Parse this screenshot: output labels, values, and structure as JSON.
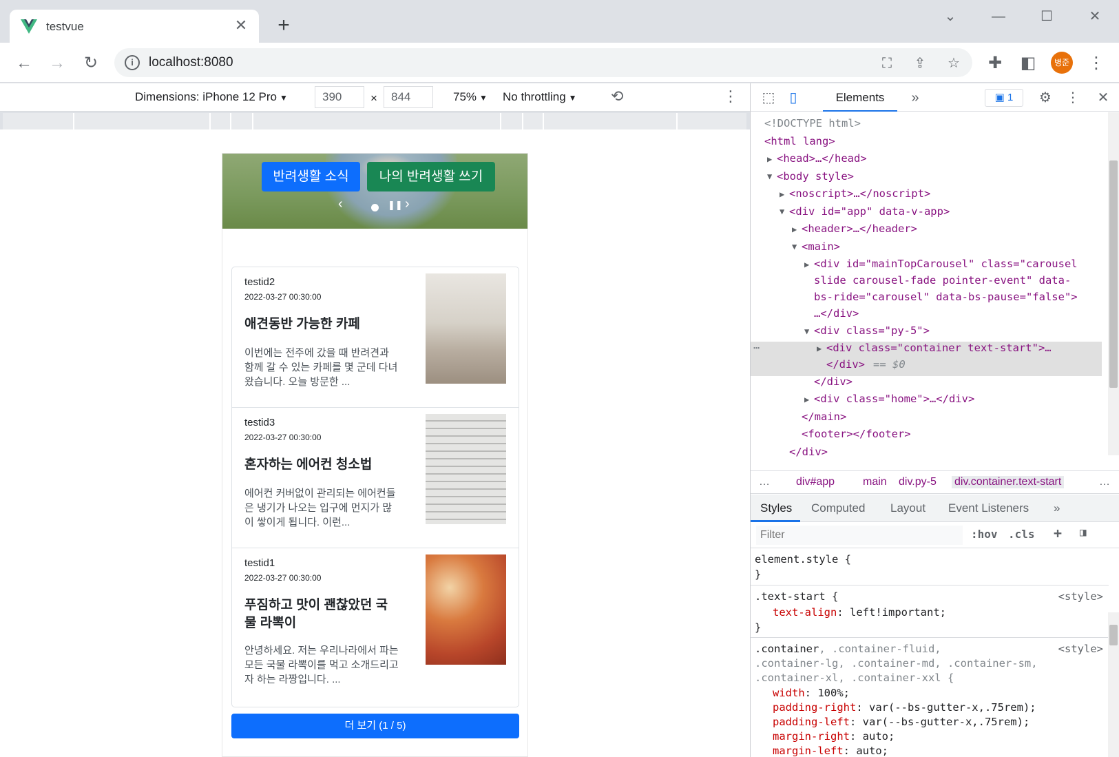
{
  "browser": {
    "tab_title": "testvue",
    "url": "localhost:8080",
    "profile_initials": "병준"
  },
  "device_toolbar": {
    "dimensions_label": "Dimensions: iPhone 12 Pro",
    "width": "390",
    "height": "844",
    "times": "×",
    "zoom": "75%",
    "throttling": "No throttling"
  },
  "page": {
    "carousel": {
      "btn_news": "반려생활 소식",
      "btn_write": "나의 반려생활 쓰기"
    },
    "posts": [
      {
        "author": "testid2",
        "date": "2022-03-27 00:30:00",
        "title": "애견동반 가능한 카페",
        "excerpt": "이번에는 전주에 갔을 때 반려견과 함께 갈 수 있는 카페를 몇 군데 다녀왔습니다. 오늘 방문한 ..."
      },
      {
        "author": "testid3",
        "date": "2022-03-27 00:30:00",
        "title": "혼자하는 에어컨 청소법",
        "excerpt": "에어컨 커버없이 관리되는 에어컨들은 냉기가 나오는 입구에 먼지가 많이 쌓이게 됩니다. 이런..."
      },
      {
        "author": "testid1",
        "date": "2022-03-27 00:30:00",
        "title": "푸짐하고 맛이 괜찮았던 국물 라뽁이",
        "excerpt": "안녕하세요. 저는 우리나라에서 파는 모든 국물 라뽁이를 먹고 소개드리고자 하는 라짱입니다. ..."
      }
    ],
    "more_button": "더 보기 (1 / 5)"
  },
  "devtools": {
    "tab_elements": "Elements",
    "issues_count": "1",
    "dom": {
      "doctype": "<!DOCTYPE html>",
      "html_open": "<html lang>",
      "head": "<head>…</head>",
      "body_open": "<body style>",
      "noscript": "<noscript>…</noscript>",
      "app_div": "<div id=\"app\" data-v-app>",
      "header": "<header>…</header>",
      "main_open": "<main>",
      "carousel_line1": "<div id=\"mainTopCarousel\" class=\"carousel",
      "carousel_line2": "slide carousel-fade pointer-event\" data-",
      "carousel_line3": "bs-ride=\"carousel\" data-bs-pause=\"false\">",
      "carousel_line4": "…</div>",
      "py5_open": "<div class=\"py-5\">",
      "container_line1": "<div class=\"container text-start\">…",
      "container_line2": "</div>",
      "eq_dollar": "== $0",
      "py5_close": "</div>",
      "home": "<div class=\"home\">…</div>",
      "main_close": "</main>",
      "footer": "<footer></footer>",
      "div_close": "</div>"
    },
    "breadcrumbs": [
      "div#app",
      "main",
      "div.py-5",
      "div.container.text-start"
    ],
    "subtabs": [
      "Styles",
      "Computed",
      "Layout",
      "Event Listeners"
    ],
    "filter_placeholder": "Filter",
    "hov": ":hov",
    "cls": ".cls",
    "styles": {
      "element_style": "element.style {",
      "close": "}",
      "text_start_selector": ".text-start {",
      "text_start_source": "<style>",
      "text_align_prop": "text-align",
      "text_align_val": "left!important;",
      "container_selector_1": ".container",
      "container_selector_1b": ", .container-fluid,",
      "container_selector_2": ".container-lg, .container-md, .container-sm,",
      "container_selector_3": ".container-xl, .container-xxl {",
      "container_source": "<style>",
      "width_prop": "width",
      "width_val": "100%;",
      "pr_prop": "padding-right",
      "pr_val": "var(--bs-gutter-x,.75rem);",
      "pl_prop": "padding-left",
      "pl_val": "var(--bs-gutter-x,.75rem);",
      "mr_prop": "margin-right",
      "mr_val": "auto;",
      "ml_prop": "margin-left",
      "ml_val": "auto;"
    }
  }
}
